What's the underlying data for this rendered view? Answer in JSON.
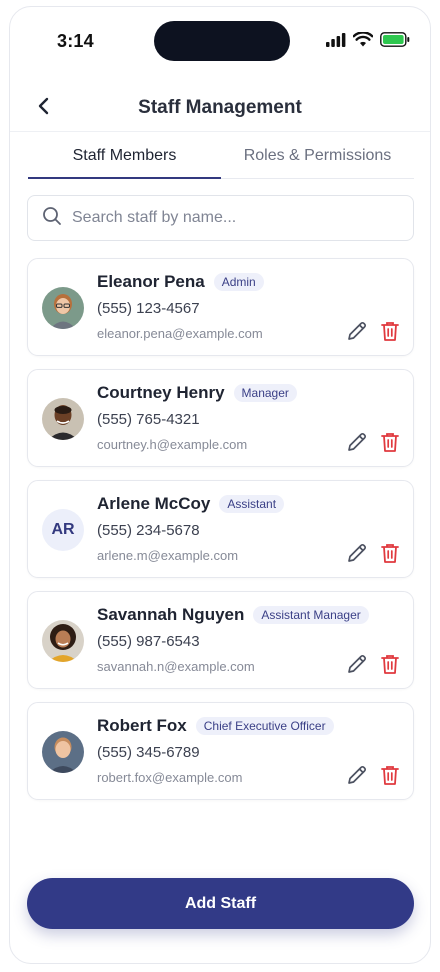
{
  "status_bar": {
    "time": "3:14"
  },
  "header": {
    "title": "Staff Management"
  },
  "tabs": [
    {
      "label": "Staff Members",
      "active": true
    },
    {
      "label": "Roles & Permissions",
      "active": false
    }
  ],
  "search": {
    "placeholder": "Search staff by name...",
    "value": ""
  },
  "staff": [
    {
      "name": "Eleanor Pena",
      "role": "Admin",
      "phone": "(555) 123-4567",
      "email": "eleanor.pena@example.com",
      "avatar": "photo"
    },
    {
      "name": "Courtney Henry",
      "role": "Manager",
      "phone": "(555) 765-4321",
      "email": "courtney.h@example.com",
      "avatar": "photo"
    },
    {
      "name": "Arlene McCoy",
      "role": "Assistant",
      "phone": "(555) 234-5678",
      "email": "arlene.m@example.com",
      "avatar": "initials",
      "initials": "AR"
    },
    {
      "name": "Savannah Nguyen",
      "role": "Assistant Manager",
      "phone": "(555) 987-6543",
      "email": "savannah.n@example.com",
      "avatar": "photo"
    },
    {
      "name": "Robert Fox",
      "role": "Chief Executive Officer",
      "phone": "(555) 345-6789",
      "email": "robert.fox@example.com",
      "avatar": "photo"
    }
  ],
  "footer": {
    "add_label": "Add Staff"
  },
  "colors": {
    "accent": "#323a87",
    "badge_bg": "#eef0fa",
    "delete": "#e0393e"
  },
  "icons": {
    "back": "chevron-left-icon",
    "search": "search-icon",
    "edit": "pencil-icon",
    "delete": "trash-icon"
  }
}
